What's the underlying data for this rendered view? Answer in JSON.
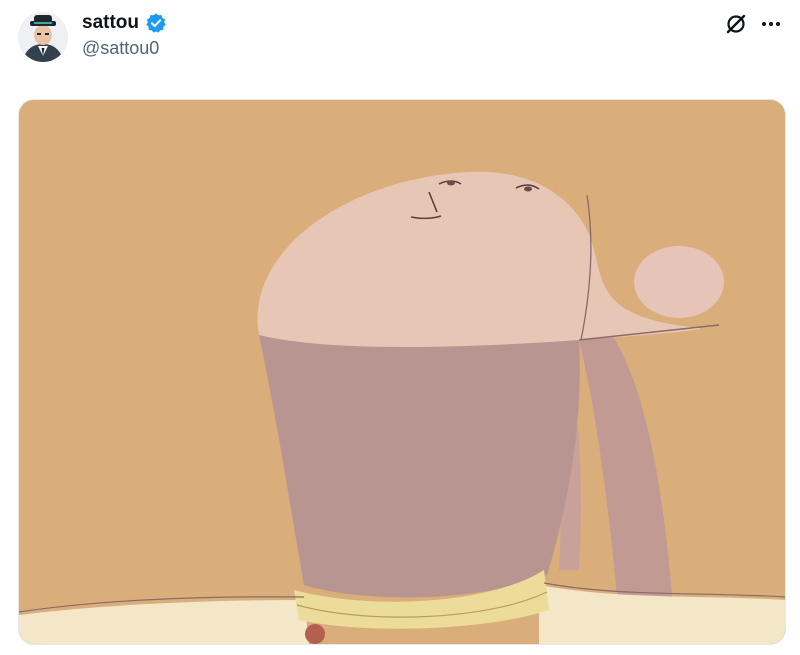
{
  "tweet": {
    "author": {
      "display_name": "sattou",
      "handle": "@sattou0",
      "verified": true,
      "avatar_icon": "avatar-character"
    },
    "actions": {
      "grok_icon": "grok-icon",
      "more_icon": "more-options-icon"
    },
    "media": {
      "type": "image",
      "subject": "anime-character-looking-up"
    }
  },
  "colors": {
    "text_primary": "#0f1419",
    "text_secondary": "#536471",
    "verified_blue": "#1d9bf0",
    "media_background": "#d9ae7a",
    "skin_light": "#e8c6b6",
    "skin_shadow": "#b89590"
  }
}
